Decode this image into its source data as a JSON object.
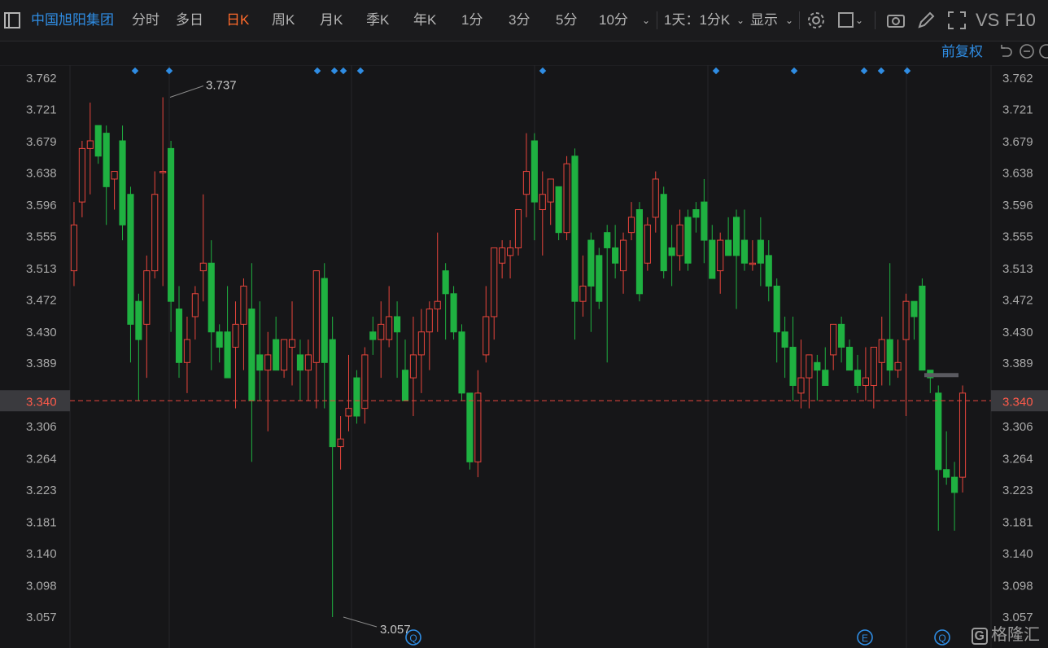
{
  "toolbar": {
    "stock_name": "中国旭阳集团",
    "tabs": [
      "分时",
      "多日",
      "日K",
      "周K",
      "月K",
      "季K",
      "年K",
      "1分",
      "3分",
      "5分",
      "10分"
    ],
    "active_tab": "日K",
    "period_selector": "1天：1分K",
    "display_label": "显示",
    "vs_label": "VS",
    "f10_label": "F10"
  },
  "fuquan_label": "前复权",
  "price_axis": [
    "3.762",
    "3.721",
    "3.679",
    "3.638",
    "3.596",
    "3.555",
    "3.513",
    "3.472",
    "3.430",
    "3.389",
    "3.306",
    "3.264",
    "3.223",
    "3.181",
    "3.140",
    "3.098",
    "3.057"
  ],
  "current_price": "3.340",
  "annotations": {
    "high": "3.737",
    "low": "3.057"
  },
  "event_markers": [
    "Q",
    "E",
    "Q"
  ],
  "watermark": "格隆汇",
  "colors": {
    "up": "#e8453c",
    "down": "#1fb141",
    "accent": "#ff6a2b",
    "link": "#2f8de4",
    "price_line": "#e8453c"
  },
  "chart_data": {
    "type": "candlestick",
    "price_range": [
      3.057,
      3.762
    ],
    "current_price": 3.34,
    "candles": [
      {
        "o": 3.51,
        "h": 3.6,
        "l": 3.49,
        "c": 3.57
      },
      {
        "o": 3.6,
        "h": 3.68,
        "l": 3.58,
        "c": 3.67
      },
      {
        "o": 3.67,
        "h": 3.73,
        "l": 3.61,
        "c": 3.68
      },
      {
        "o": 3.7,
        "h": 3.7,
        "l": 3.65,
        "c": 3.66
      },
      {
        "o": 3.69,
        "h": 3.7,
        "l": 3.57,
        "c": 3.62
      },
      {
        "o": 3.63,
        "h": 3.64,
        "l": 3.59,
        "c": 3.64
      },
      {
        "o": 3.68,
        "h": 3.7,
        "l": 3.55,
        "c": 3.57
      },
      {
        "o": 3.61,
        "h": 3.62,
        "l": 3.39,
        "c": 3.44
      },
      {
        "o": 3.47,
        "h": 3.48,
        "l": 3.34,
        "c": 3.42
      },
      {
        "o": 3.44,
        "h": 3.53,
        "l": 3.37,
        "c": 3.51
      },
      {
        "o": 3.51,
        "h": 3.64,
        "l": 3.5,
        "c": 3.61
      },
      {
        "o": 3.64,
        "h": 3.737,
        "l": 3.49,
        "c": 3.64
      },
      {
        "o": 3.67,
        "h": 3.68,
        "l": 3.43,
        "c": 3.47
      },
      {
        "o": 3.46,
        "h": 3.49,
        "l": 3.37,
        "c": 3.39
      },
      {
        "o": 3.39,
        "h": 3.45,
        "l": 3.35,
        "c": 3.42
      },
      {
        "o": 3.45,
        "h": 3.49,
        "l": 3.42,
        "c": 3.48
      },
      {
        "o": 3.51,
        "h": 3.61,
        "l": 3.47,
        "c": 3.52
      },
      {
        "o": 3.52,
        "h": 3.55,
        "l": 3.38,
        "c": 3.43
      },
      {
        "o": 3.43,
        "h": 3.44,
        "l": 3.39,
        "c": 3.41
      },
      {
        "o": 3.43,
        "h": 3.49,
        "l": 3.38,
        "c": 3.37
      },
      {
        "o": 3.41,
        "h": 3.47,
        "l": 3.33,
        "c": 3.44
      },
      {
        "o": 3.44,
        "h": 3.5,
        "l": 3.38,
        "c": 3.49
      },
      {
        "o": 3.46,
        "h": 3.52,
        "l": 3.26,
        "c": 3.34
      },
      {
        "o": 3.4,
        "h": 3.47,
        "l": 3.34,
        "c": 3.38
      },
      {
        "o": 3.38,
        "h": 3.43,
        "l": 3.3,
        "c": 3.4
      },
      {
        "o": 3.42,
        "h": 3.45,
        "l": 3.39,
        "c": 3.38
      },
      {
        "o": 3.38,
        "h": 3.42,
        "l": 3.37,
        "c": 3.42
      },
      {
        "o": 3.41,
        "h": 3.47,
        "l": 3.36,
        "c": 3.42
      },
      {
        "o": 3.4,
        "h": 3.42,
        "l": 3.34,
        "c": 3.38
      },
      {
        "o": 3.38,
        "h": 3.42,
        "l": 3.34,
        "c": 3.4
      },
      {
        "o": 3.39,
        "h": 3.51,
        "l": 3.33,
        "c": 3.51
      },
      {
        "o": 3.5,
        "h": 3.52,
        "l": 3.33,
        "c": 3.39
      },
      {
        "o": 3.42,
        "h": 3.45,
        "l": 3.057,
        "c": 3.28
      },
      {
        "o": 3.28,
        "h": 3.32,
        "l": 3.25,
        "c": 3.29
      },
      {
        "o": 3.32,
        "h": 3.4,
        "l": 3.3,
        "c": 3.33
      },
      {
        "o": 3.37,
        "h": 3.38,
        "l": 3.31,
        "c": 3.32
      },
      {
        "o": 3.33,
        "h": 3.41,
        "l": 3.31,
        "c": 3.4
      },
      {
        "o": 3.43,
        "h": 3.45,
        "l": 3.4,
        "c": 3.42
      },
      {
        "o": 3.42,
        "h": 3.47,
        "l": 3.37,
        "c": 3.44
      },
      {
        "o": 3.42,
        "h": 3.49,
        "l": 3.41,
        "c": 3.45
      },
      {
        "o": 3.45,
        "h": 3.47,
        "l": 3.37,
        "c": 3.43
      },
      {
        "o": 3.38,
        "h": 3.42,
        "l": 3.35,
        "c": 3.34
      },
      {
        "o": 3.37,
        "h": 3.45,
        "l": 3.32,
        "c": 3.4
      },
      {
        "o": 3.4,
        "h": 3.46,
        "l": 3.35,
        "c": 3.43
      },
      {
        "o": 3.43,
        "h": 3.47,
        "l": 3.38,
        "c": 3.46
      },
      {
        "o": 3.46,
        "h": 3.56,
        "l": 3.43,
        "c": 3.47
      },
      {
        "o": 3.51,
        "h": 3.52,
        "l": 3.42,
        "c": 3.48
      },
      {
        "o": 3.48,
        "h": 3.49,
        "l": 3.42,
        "c": 3.43
      },
      {
        "o": 3.43,
        "h": 3.44,
        "l": 3.34,
        "c": 3.35
      },
      {
        "o": 3.35,
        "h": 3.35,
        "l": 3.25,
        "c": 3.26
      },
      {
        "o": 3.26,
        "h": 3.38,
        "l": 3.24,
        "c": 3.35
      },
      {
        "o": 3.4,
        "h": 3.49,
        "l": 3.39,
        "c": 3.45
      },
      {
        "o": 3.45,
        "h": 3.52,
        "l": 3.42,
        "c": 3.54
      },
      {
        "o": 3.52,
        "h": 3.55,
        "l": 3.5,
        "c": 3.54
      },
      {
        "o": 3.53,
        "h": 3.55,
        "l": 3.5,
        "c": 3.54
      },
      {
        "o": 3.54,
        "h": 3.59,
        "l": 3.53,
        "c": 3.59
      },
      {
        "o": 3.61,
        "h": 3.69,
        "l": 3.58,
        "c": 3.64
      },
      {
        "o": 3.68,
        "h": 3.69,
        "l": 3.55,
        "c": 3.6
      },
      {
        "o": 3.59,
        "h": 3.64,
        "l": 3.53,
        "c": 3.61
      },
      {
        "o": 3.6,
        "h": 3.63,
        "l": 3.57,
        "c": 3.63
      },
      {
        "o": 3.62,
        "h": 3.62,
        "l": 3.55,
        "c": 3.56
      },
      {
        "o": 3.56,
        "h": 3.66,
        "l": 3.55,
        "c": 3.65
      },
      {
        "o": 3.66,
        "h": 3.67,
        "l": 3.42,
        "c": 3.47
      },
      {
        "o": 3.47,
        "h": 3.53,
        "l": 3.45,
        "c": 3.49
      },
      {
        "o": 3.55,
        "h": 3.56,
        "l": 3.43,
        "c": 3.49
      },
      {
        "o": 3.53,
        "h": 3.54,
        "l": 3.46,
        "c": 3.47
      },
      {
        "o": 3.56,
        "h": 3.57,
        "l": 3.39,
        "c": 3.54
      },
      {
        "o": 3.54,
        "h": 3.57,
        "l": 3.5,
        "c": 3.52
      },
      {
        "o": 3.51,
        "h": 3.56,
        "l": 3.48,
        "c": 3.55
      },
      {
        "o": 3.56,
        "h": 3.6,
        "l": 3.55,
        "c": 3.58
      },
      {
        "o": 3.59,
        "h": 3.6,
        "l": 3.47,
        "c": 3.48
      },
      {
        "o": 3.52,
        "h": 3.58,
        "l": 3.51,
        "c": 3.57
      },
      {
        "o": 3.58,
        "h": 3.64,
        "l": 3.56,
        "c": 3.63
      },
      {
        "o": 3.61,
        "h": 3.62,
        "l": 3.5,
        "c": 3.51
      },
      {
        "o": 3.54,
        "h": 3.57,
        "l": 3.49,
        "c": 3.53
      },
      {
        "o": 3.53,
        "h": 3.59,
        "l": 3.51,
        "c": 3.57
      },
      {
        "o": 3.58,
        "h": 3.59,
        "l": 3.51,
        "c": 3.52
      },
      {
        "o": 3.59,
        "h": 3.6,
        "l": 3.56,
        "c": 3.58
      },
      {
        "o": 3.6,
        "h": 3.63,
        "l": 3.52,
        "c": 3.55
      },
      {
        "o": 3.55,
        "h": 3.57,
        "l": 3.5,
        "c": 3.5
      },
      {
        "o": 3.51,
        "h": 3.56,
        "l": 3.48,
        "c": 3.55
      },
      {
        "o": 3.55,
        "h": 3.58,
        "l": 3.53,
        "c": 3.53
      },
      {
        "o": 3.58,
        "h": 3.59,
        "l": 3.46,
        "c": 3.53
      },
      {
        "o": 3.55,
        "h": 3.59,
        "l": 3.51,
        "c": 3.52
      },
      {
        "o": 3.52,
        "h": 3.55,
        "l": 3.51,
        "c": 3.52
      },
      {
        "o": 3.55,
        "h": 3.58,
        "l": 3.49,
        "c": 3.52
      },
      {
        "o": 3.53,
        "h": 3.55,
        "l": 3.47,
        "c": 3.49
      },
      {
        "o": 3.49,
        "h": 3.5,
        "l": 3.39,
        "c": 3.43
      },
      {
        "o": 3.43,
        "h": 3.45,
        "l": 3.37,
        "c": 3.41
      },
      {
        "o": 3.41,
        "h": 3.45,
        "l": 3.34,
        "c": 3.36
      },
      {
        "o": 3.35,
        "h": 3.42,
        "l": 3.33,
        "c": 3.37
      },
      {
        "o": 3.37,
        "h": 3.4,
        "l": 3.33,
        "c": 3.4
      },
      {
        "o": 3.39,
        "h": 3.4,
        "l": 3.34,
        "c": 3.38
      },
      {
        "o": 3.38,
        "h": 3.41,
        "l": 3.36,
        "c": 3.36
      },
      {
        "o": 3.4,
        "h": 3.44,
        "l": 3.38,
        "c": 3.44
      },
      {
        "o": 3.44,
        "h": 3.45,
        "l": 3.39,
        "c": 3.41
      },
      {
        "o": 3.41,
        "h": 3.42,
        "l": 3.38,
        "c": 3.38
      },
      {
        "o": 3.38,
        "h": 3.4,
        "l": 3.35,
        "c": 3.36
      },
      {
        "o": 3.36,
        "h": 3.41,
        "l": 3.34,
        "c": 3.37
      },
      {
        "o": 3.36,
        "h": 3.4,
        "l": 3.33,
        "c": 3.41
      },
      {
        "o": 3.39,
        "h": 3.45,
        "l": 3.36,
        "c": 3.42
      },
      {
        "o": 3.42,
        "h": 3.52,
        "l": 3.36,
        "c": 3.38
      },
      {
        "o": 3.38,
        "h": 3.42,
        "l": 3.37,
        "c": 3.39
      },
      {
        "o": 3.42,
        "h": 3.48,
        "l": 3.32,
        "c": 3.47
      },
      {
        "o": 3.47,
        "h": 3.47,
        "l": 3.42,
        "c": 3.45
      },
      {
        "o": 3.49,
        "h": 3.5,
        "l": 3.38,
        "c": 3.38
      },
      {
        "o": 3.38,
        "h": 3.38,
        "l": 3.35,
        "c": 3.37
      },
      {
        "o": 3.35,
        "h": 3.36,
        "l": 3.17,
        "c": 3.25
      },
      {
        "o": 3.25,
        "h": 3.3,
        "l": 3.23,
        "c": 3.24
      },
      {
        "o": 3.24,
        "h": 3.26,
        "l": 3.17,
        "c": 3.22
      },
      {
        "o": 3.24,
        "h": 3.36,
        "l": 3.22,
        "c": 3.35
      }
    ]
  }
}
